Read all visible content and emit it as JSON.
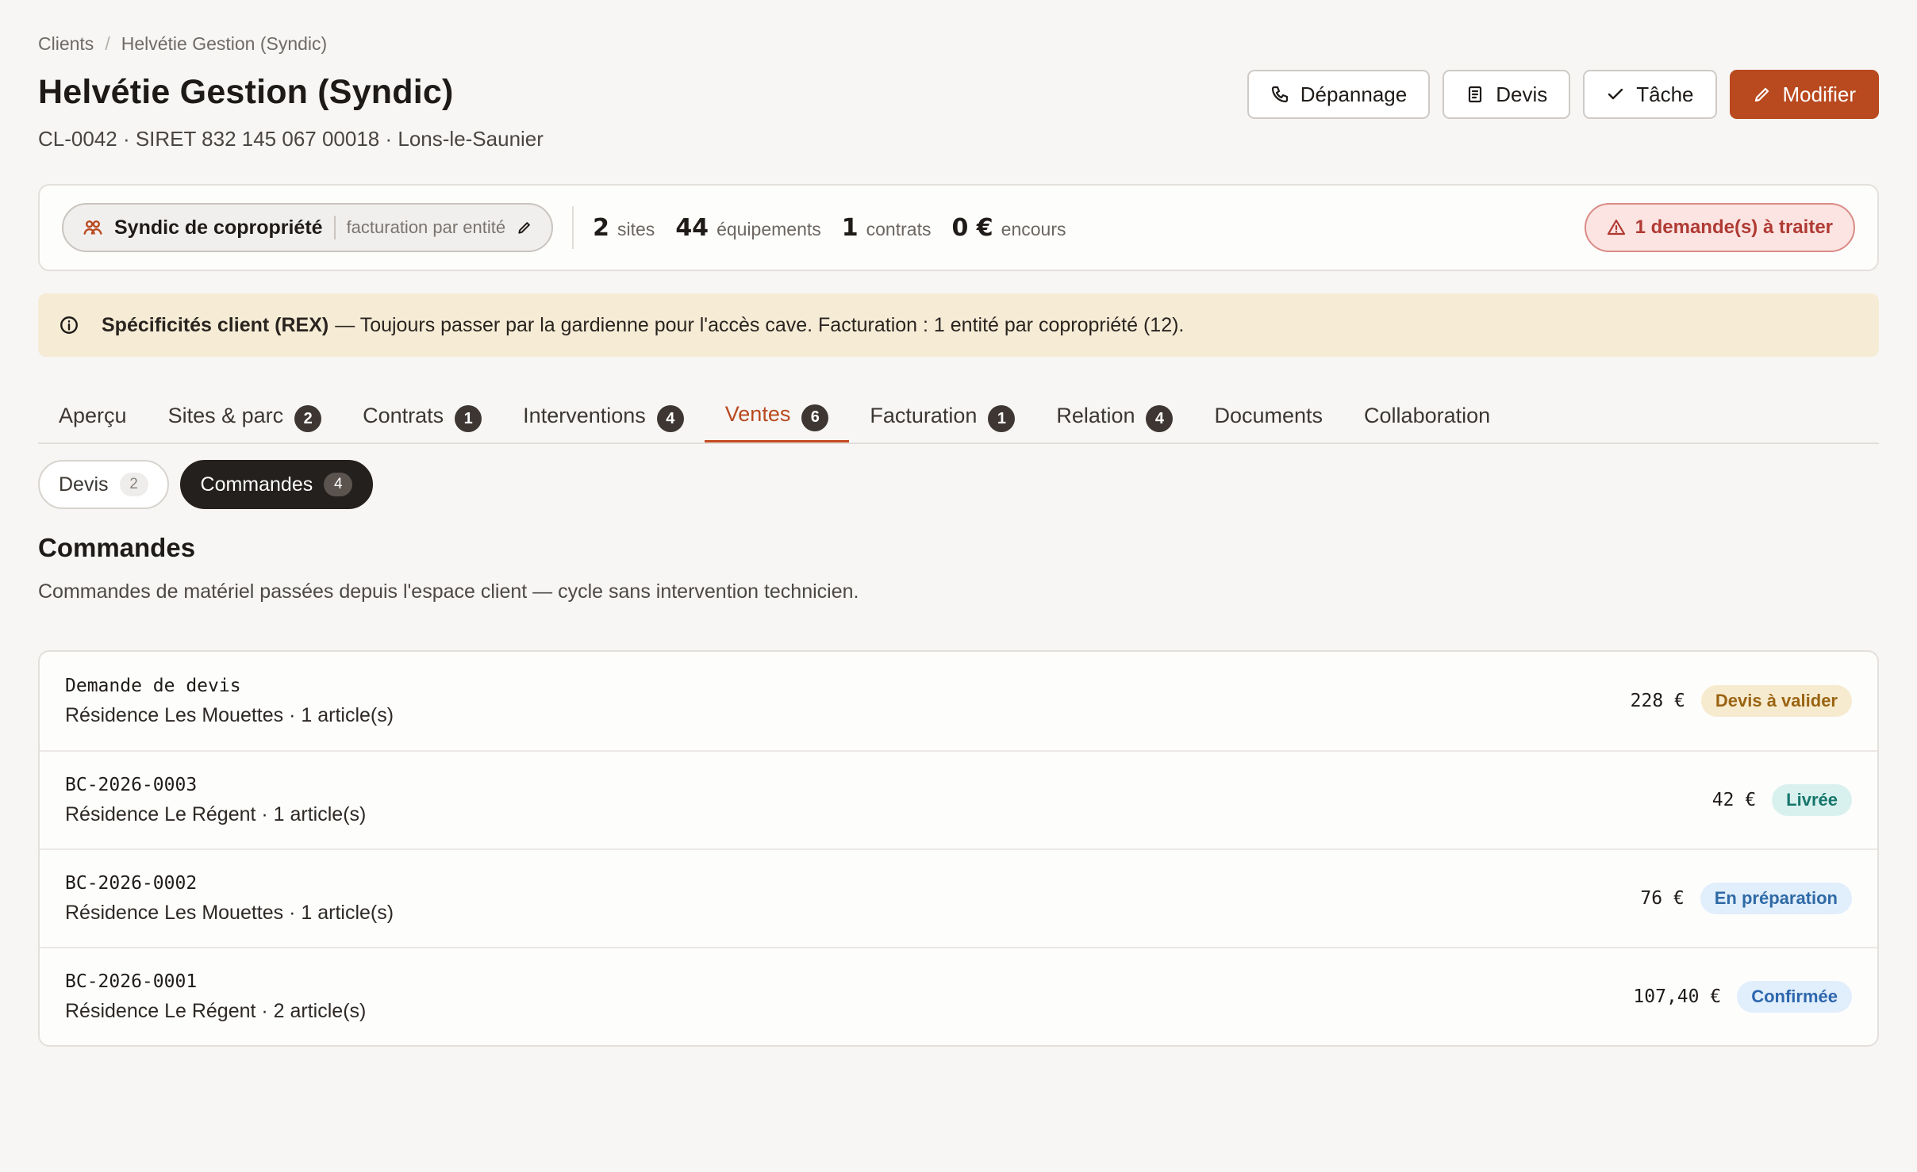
{
  "breadcrumb": {
    "root": "Clients",
    "separator": "/",
    "current": "Helvétie Gestion (Syndic)"
  },
  "header": {
    "title": "Helvétie Gestion (Syndic)",
    "subtitle": "CL-0042 · SIRET 832 145 067 00018 · Lons-le-Saunier",
    "actions": {
      "depannage": "Dépannage",
      "devis": "Devis",
      "tache": "Tâche",
      "modifier": "Modifier"
    }
  },
  "summary": {
    "type_label": "Syndic de copropriété",
    "type_sub": "facturation par entité",
    "stats": [
      {
        "num": "2",
        "unit": "sites"
      },
      {
        "num": "44",
        "unit": "équipements"
      },
      {
        "num": "1",
        "unit": "contrats"
      },
      {
        "num": "0 €",
        "unit": "encours"
      }
    ],
    "alert": "1 demande(s) à traiter"
  },
  "banner": {
    "bold": "Spécificités client (REX)",
    "text": "— Toujours passer par la gardienne pour l'accès cave. Facturation : 1 entité par copropriété (12)."
  },
  "tabs": [
    {
      "label": "Aperçu",
      "count": null
    },
    {
      "label": "Sites & parc",
      "count": "2"
    },
    {
      "label": "Contrats",
      "count": "1"
    },
    {
      "label": "Interventions",
      "count": "4"
    },
    {
      "label": "Ventes",
      "count": "6"
    },
    {
      "label": "Facturation",
      "count": "1"
    },
    {
      "label": "Relation",
      "count": "4"
    },
    {
      "label": "Documents",
      "count": null
    },
    {
      "label": "Collaboration",
      "count": null
    }
  ],
  "segments": [
    {
      "label": "Devis",
      "count": "2"
    },
    {
      "label": "Commandes",
      "count": "4"
    }
  ],
  "section": {
    "title": "Commandes",
    "description": "Commandes de matériel passées depuis l'espace client — cycle sans intervention technicien."
  },
  "orders": [
    {
      "ref": "Demande de devis",
      "meta": "Résidence Les Mouettes · 1 article(s)",
      "amount": "228 €",
      "status": "Devis à valider"
    },
    {
      "ref": "BC-2026-0003",
      "meta": "Résidence Le Régent · 1 article(s)",
      "amount": "42 €",
      "status": "Livrée"
    },
    {
      "ref": "BC-2026-0002",
      "meta": "Résidence Les Mouettes · 1 article(s)",
      "amount": "76 €",
      "status": "En préparation"
    },
    {
      "ref": "BC-2026-0001",
      "meta": "Résidence Le Régent · 2 article(s)",
      "amount": "107,40 €",
      "status": "Confirmée"
    }
  ],
  "colors": {
    "accent": "#b9491f",
    "alert": "#b03a34",
    "banner_bg": "#f6ecd6"
  }
}
